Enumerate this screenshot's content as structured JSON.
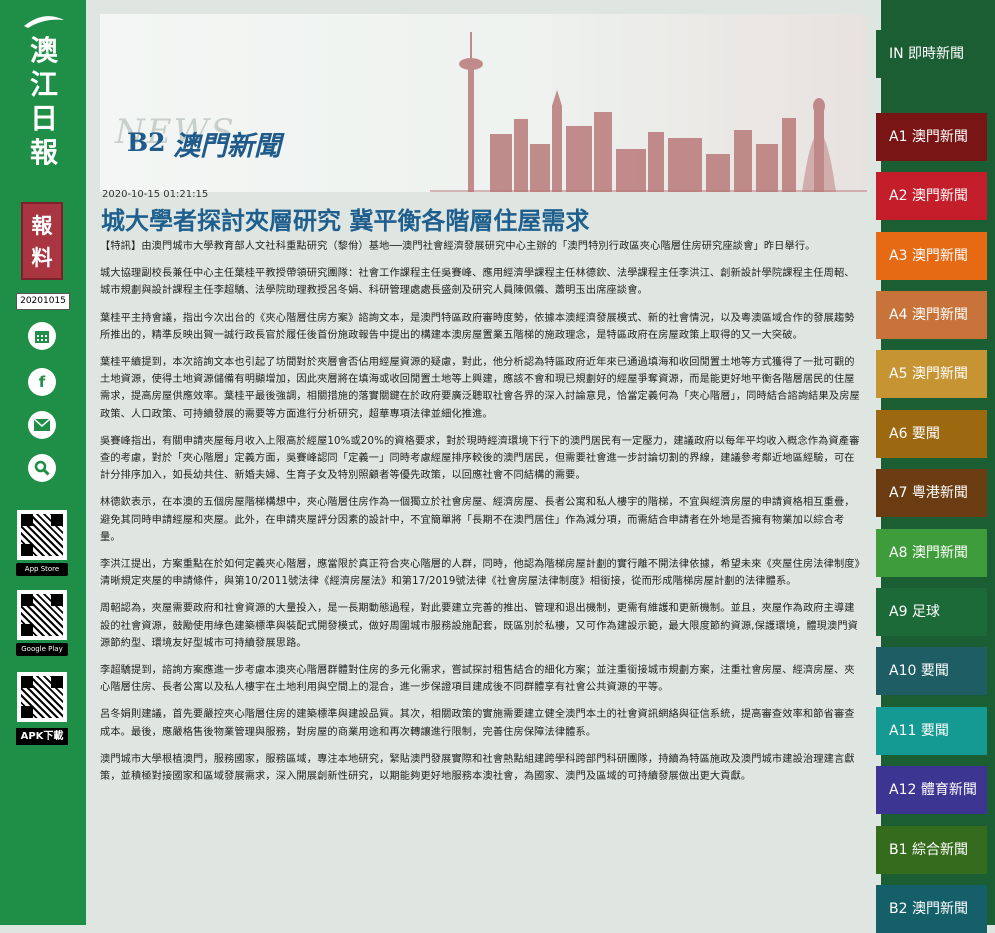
{
  "sidebar": {
    "logo_chars": [
      "澳",
      "江",
      "日",
      "報"
    ],
    "baoliao": [
      "報",
      "料"
    ],
    "date": "20201015",
    "icons": [
      "calendar-icon",
      "facebook-icon",
      "mail-icon",
      "search-icon"
    ],
    "app_store": "App Store",
    "google_play": "Google Play",
    "apk": "APK下載"
  },
  "header": {
    "ghost": "NEWS",
    "section_code": "B2",
    "section_name": "澳門新聞"
  },
  "article": {
    "timestamp": "2020-10-15 01:21:15",
    "title": "城大學者探討夾層研究 冀平衡各階層住屋需求",
    "paragraphs": [
      "【特訊】由澳門城市大學教育部人文社科重點研究（黎佾）基地──澳門社會經濟發展研究中心主辦的「澳門特別行政區夾心階層住房研究座談會」昨日舉行。",
      "城大協理副校長兼任中心主任葉桂平教授帶領研究團隊：社會工作課程主任吳賽峰、應用經濟學課程主任林德欽、法學課程主任李洪江、創新設計學院課程主任周軺、城市規劃與設計課程主任李超驕、法學院助理教授呂冬娟、科研管理處處長盛劍及研究人員陳佩儀、蕭明玉出席座談會。",
      "葉桂平主持會議，指出今次出台的《夾心階層住房方案》諮詢文本，是澳門特區政府審時度勢，依據本澳經濟發展模式、新的社會情況，以及粵澳區域合作的發展趨勢所推出的，精準反映出賀一誠行政長官於履任後首份施政報告中提出的構建本澳房屋置業五階梯的施政理念，是特區政府在房屋政策上取得的又一大突破。",
      "葉桂平續提到，本次諮詢文本也引起了坊間對於夾層會否佔用經屋資源的疑慮，對此，他分析認為特區政府近年來已通過填海和收回閒置土地等方式獲得了一批可觀的土地資源，使得土地資源儲備有明顯增加，因此夾層將在填海或收回閒置土地等上興建，應該不會和現已規劃好的經屋爭奪資源，而是能更好地平衡各階層居民的住屋需求，提高房屋供應效率。葉桂平最後強調，相關措施的落實關鍵在於政府要廣泛聽取社會各界的深入討論意見，恰當定義何為「夾心階層」，同時結合諮詢結果及房屋政策、人口政策、可持續發展的需要等方面進行分析研究，超華專項法律並細化推進。",
      "吳賽峰指出，有關申請夾屋每月收入上限高於經屋10%或20%的資格要求，對於現時經濟環境下行下的澳門居民有一定壓力，建議政府以每年平均收入概念作為資產審查的考慮，對於「夾心階層」定義方面，吳賽峰認同「定義一」同時考慮經屋排序較後的澳門居民，但需要社會進一步討論切割的界線，建議參考鄰近地區經驗，可在計分排序加入，如長幼共住、新婚夫婦、生育子女及特別照顧者等優先政策，以回應社會不同結構的需要。",
      "林德欽表示，在本澳的五個房屋階梯構想中，夾心階層住房作為一個獨立於社會房屋、經濟房屋、長者公寓和私人樓宇的階梯，不宜與經濟房屋的申請資格相互重疊，避免其同時申請經屋和夾屋。此外，在申請夾屋評分因素的設計中，不宜簡單將「長期不在澳門居住」作為減分項，而需結合申請者在外地是否擁有物業加以綜合考量。",
      "李洪江提出，方案重點在於如何定義夾心階層，應當限於真正符合夾心階層的人群，同時，他認為階梯房屋計劃的實行離不開法律依據，希望未來《夾屋住房法律制度》清晰規定夾屋的申請條件，與第10/2011號法律《經濟房屋法》和第17/2019號法律《社會房屋法律制度》相銜接，從而形成階梯房屋計劃的法律體系。",
      "周軺認為，夾屋需要政府和社會資源的大量投入，是一長期動態過程，對此要建立完善的推出、管理和退出機制，更需有維護和更新機制。並且，夾屋作為政府主導建設的社會資源，鼓勵使用綠色建築標準與裝配式開發模式，做好周圍城市服務設施配套，既區別於私樓，又可作為建設示範，最大限度節約資源,保護環境，體現澳門資源節約型、環境友好型城市可持續發展思路。",
      "李超驕提到，諮詢方案應進一步考慮本澳夾心階層群體對住房的多元化需求，嘗試探討租售結合的細化方案；並注重銜接城市規劃方案，注重社會房屋、經濟房屋、夾心階層住房、長者公寓以及私人樓宇在土地利用與空間上的混合，進一步保證項目建成後不同群體享有社會公共資源的平等。",
      "呂冬娟則建議，首先要嚴控夾心階層住房的建築標準與建設品質。其次，相關政策的實施需要建立健全澳門本土的社會資訊網絡與征信系統，提高審查效率和節省審查成本。最後，應嚴格售後物業管理與服務，對房屋的商業用途和再次轉讓進行限制，完善住房保障法律體系。",
      "澳門城市大學根植澳門，服務國家，服務區域，專注本地研究，緊貼澳門發展實際和社會熱點組建跨學科跨部門科研團隊，持續為特區施政及澳門城市建設治理建言獻策，並積極對接國家和區域發展需求，深入開展創新性研究，以期能夠更好地服務本澳社會，為國家、澳門及區域的可持續發展做出更大貢獻。"
    ]
  },
  "nav": {
    "items": [
      {
        "label": "IN 即時新聞",
        "color": "#1b5e34"
      },
      {
        "label": "A1 澳門新聞",
        "color": "#7a1515"
      },
      {
        "label": "A2 澳門新聞",
        "color": "#c41e2a"
      },
      {
        "label": "A3 澳門新聞",
        "color": "#e66a14"
      },
      {
        "label": "A4 澳門新聞",
        "color": "#c8733a"
      },
      {
        "label": "A5 澳門新聞",
        "color": "#c79433"
      },
      {
        "label": "A6 要聞",
        "color": "#9c6810"
      },
      {
        "label": "A7 粵港新聞",
        "color": "#6b3b11"
      },
      {
        "label": "A8 澳門新聞",
        "color": "#3f9c3a"
      },
      {
        "label": "A9 足球",
        "color": "#1c6a37"
      },
      {
        "label": "A10 要聞",
        "color": "#1d5d63"
      },
      {
        "label": "A11 要聞",
        "color": "#149a93"
      },
      {
        "label": "A12 體育新聞",
        "color": "#3d3592"
      },
      {
        "label": "B1 綜合新聞",
        "color": "#356b1d"
      },
      {
        "label": "B2 澳門新聞",
        "color": "#156068"
      }
    ]
  }
}
